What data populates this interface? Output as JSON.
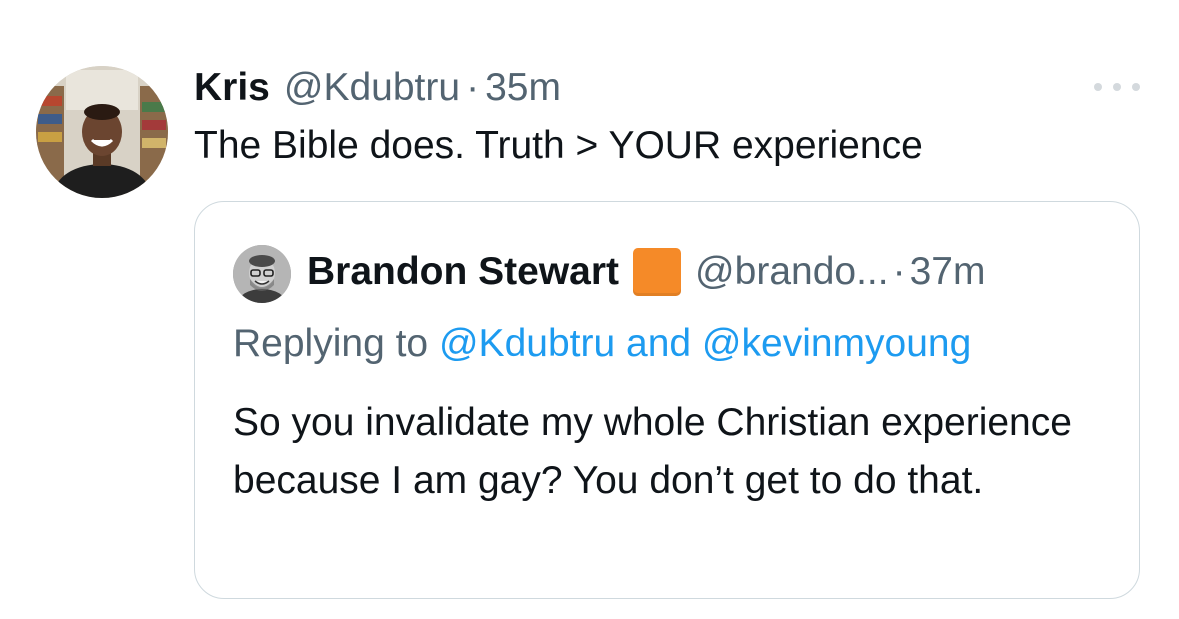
{
  "tweet": {
    "display_name": "Kris",
    "handle": "@Kdubtru",
    "separator": "·",
    "time": "35m",
    "text": "The Bible does. Truth > YOUR experience",
    "avatar_icon": "user-avatar-photo",
    "more_icon": "more-options-icon"
  },
  "quoted": {
    "display_name": "Brandon Stewart",
    "flag_color": "#f58a28",
    "handle": "@brando...",
    "separator": "·",
    "time": "37m",
    "replying_prefix": "Replying to",
    "mention_1": "@Kdubtru",
    "conjunction": "and",
    "mention_2": "@kevinmyoung",
    "text": "So you invalidate my whole Christian experience because I am gay?  You don’t get to do that."
  },
  "colors": {
    "text_primary": "#0f1419",
    "text_secondary": "#536471",
    "link": "#1d9bf0",
    "card_border": "#cfd9de"
  }
}
